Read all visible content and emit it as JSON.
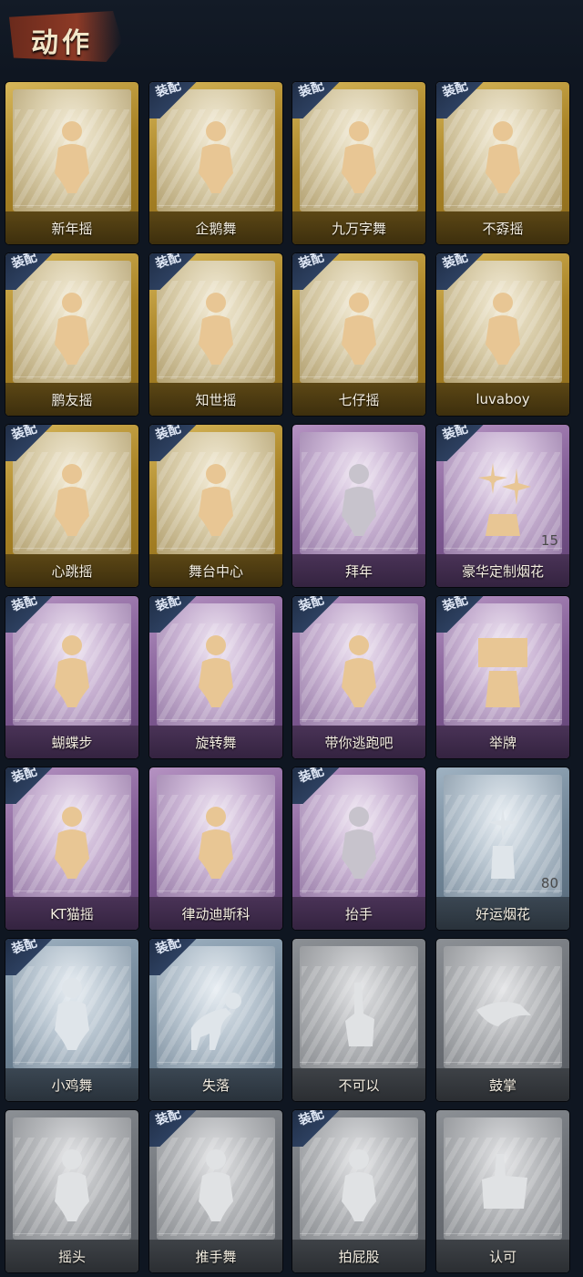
{
  "header": {
    "title": "动作"
  },
  "equip_label": "装配",
  "cards": [
    {
      "label": "新年摇",
      "rarity": "gold",
      "equipped": false,
      "icon": "dance-figure-icon"
    },
    {
      "label": "企鹅舞",
      "rarity": "gold",
      "equipped": true,
      "icon": "dance-figure-icon"
    },
    {
      "label": "九万字舞",
      "rarity": "gold",
      "equipped": true,
      "icon": "dance-figure-icon"
    },
    {
      "label": "不孬摇",
      "rarity": "gold",
      "equipped": true,
      "icon": "dance-figure-icon"
    },
    {
      "label": "鹏友摇",
      "rarity": "gold",
      "equipped": true,
      "icon": "dance-figure-icon"
    },
    {
      "label": "知世摇",
      "rarity": "gold",
      "equipped": true,
      "icon": "dance-figure-icon"
    },
    {
      "label": "七仔摇",
      "rarity": "gold",
      "equipped": true,
      "icon": "dance-figure-icon"
    },
    {
      "label": "luvaboy",
      "rarity": "gold",
      "equipped": true,
      "icon": "dance-figure-icon"
    },
    {
      "label": "心跳摇",
      "rarity": "gold",
      "equipped": true,
      "icon": "dance-figure-icon"
    },
    {
      "label": "舞台中心",
      "rarity": "gold",
      "equipped": true,
      "icon": "dance-figure-icon"
    },
    {
      "label": "拜年",
      "rarity": "purple",
      "equipped": false,
      "locked": true,
      "icon": "bow-figure-icon"
    },
    {
      "label": "豪华定制烟花",
      "rarity": "purple",
      "equipped": true,
      "icon": "fireworks-icon",
      "count": "15"
    },
    {
      "label": "蝴蝶步",
      "rarity": "purple",
      "equipped": true,
      "icon": "dance-figure-icon"
    },
    {
      "label": "旋转舞",
      "rarity": "purple",
      "equipped": true,
      "icon": "dance-figure-icon"
    },
    {
      "label": "带你逃跑吧",
      "rarity": "purple",
      "equipped": true,
      "icon": "dance-figure-icon"
    },
    {
      "label": "举牌",
      "rarity": "purple",
      "equipped": true,
      "icon": "sign-figure-icon"
    },
    {
      "label": "KT猫摇",
      "rarity": "purple",
      "equipped": true,
      "icon": "dance-figure-icon"
    },
    {
      "label": "律动迪斯科",
      "rarity": "purple",
      "equipped": false,
      "icon": "dance-figure-icon"
    },
    {
      "label": "抬手",
      "rarity": "purple",
      "equipped": true,
      "locked": true,
      "icon": "raise-hand-figure-icon"
    },
    {
      "label": "好运烟花",
      "rarity": "blue",
      "equipped": false,
      "icon": "firework-can-icon",
      "count": "80"
    },
    {
      "label": "小鸡舞",
      "rarity": "blue",
      "equipped": true,
      "icon": "dance-figure-icon"
    },
    {
      "label": "失落",
      "rarity": "blue",
      "equipped": true,
      "icon": "crawl-figure-icon"
    },
    {
      "label": "不可以",
      "rarity": "gray",
      "equipped": false,
      "icon": "finger-wag-icon"
    },
    {
      "label": "鼓掌",
      "rarity": "gray",
      "equipped": false,
      "icon": "clap-hands-icon"
    },
    {
      "label": "摇头",
      "rarity": "gray",
      "equipped": false,
      "icon": "shake-head-figure-icon"
    },
    {
      "label": "推手舞",
      "rarity": "gray",
      "equipped": true,
      "icon": "dance-figure-icon"
    },
    {
      "label": "拍屁股",
      "rarity": "gray",
      "equipped": true,
      "icon": "dance-figure-icon"
    },
    {
      "label": "认可",
      "rarity": "gray",
      "equipped": false,
      "icon": "thumbs-up-icon"
    }
  ]
}
